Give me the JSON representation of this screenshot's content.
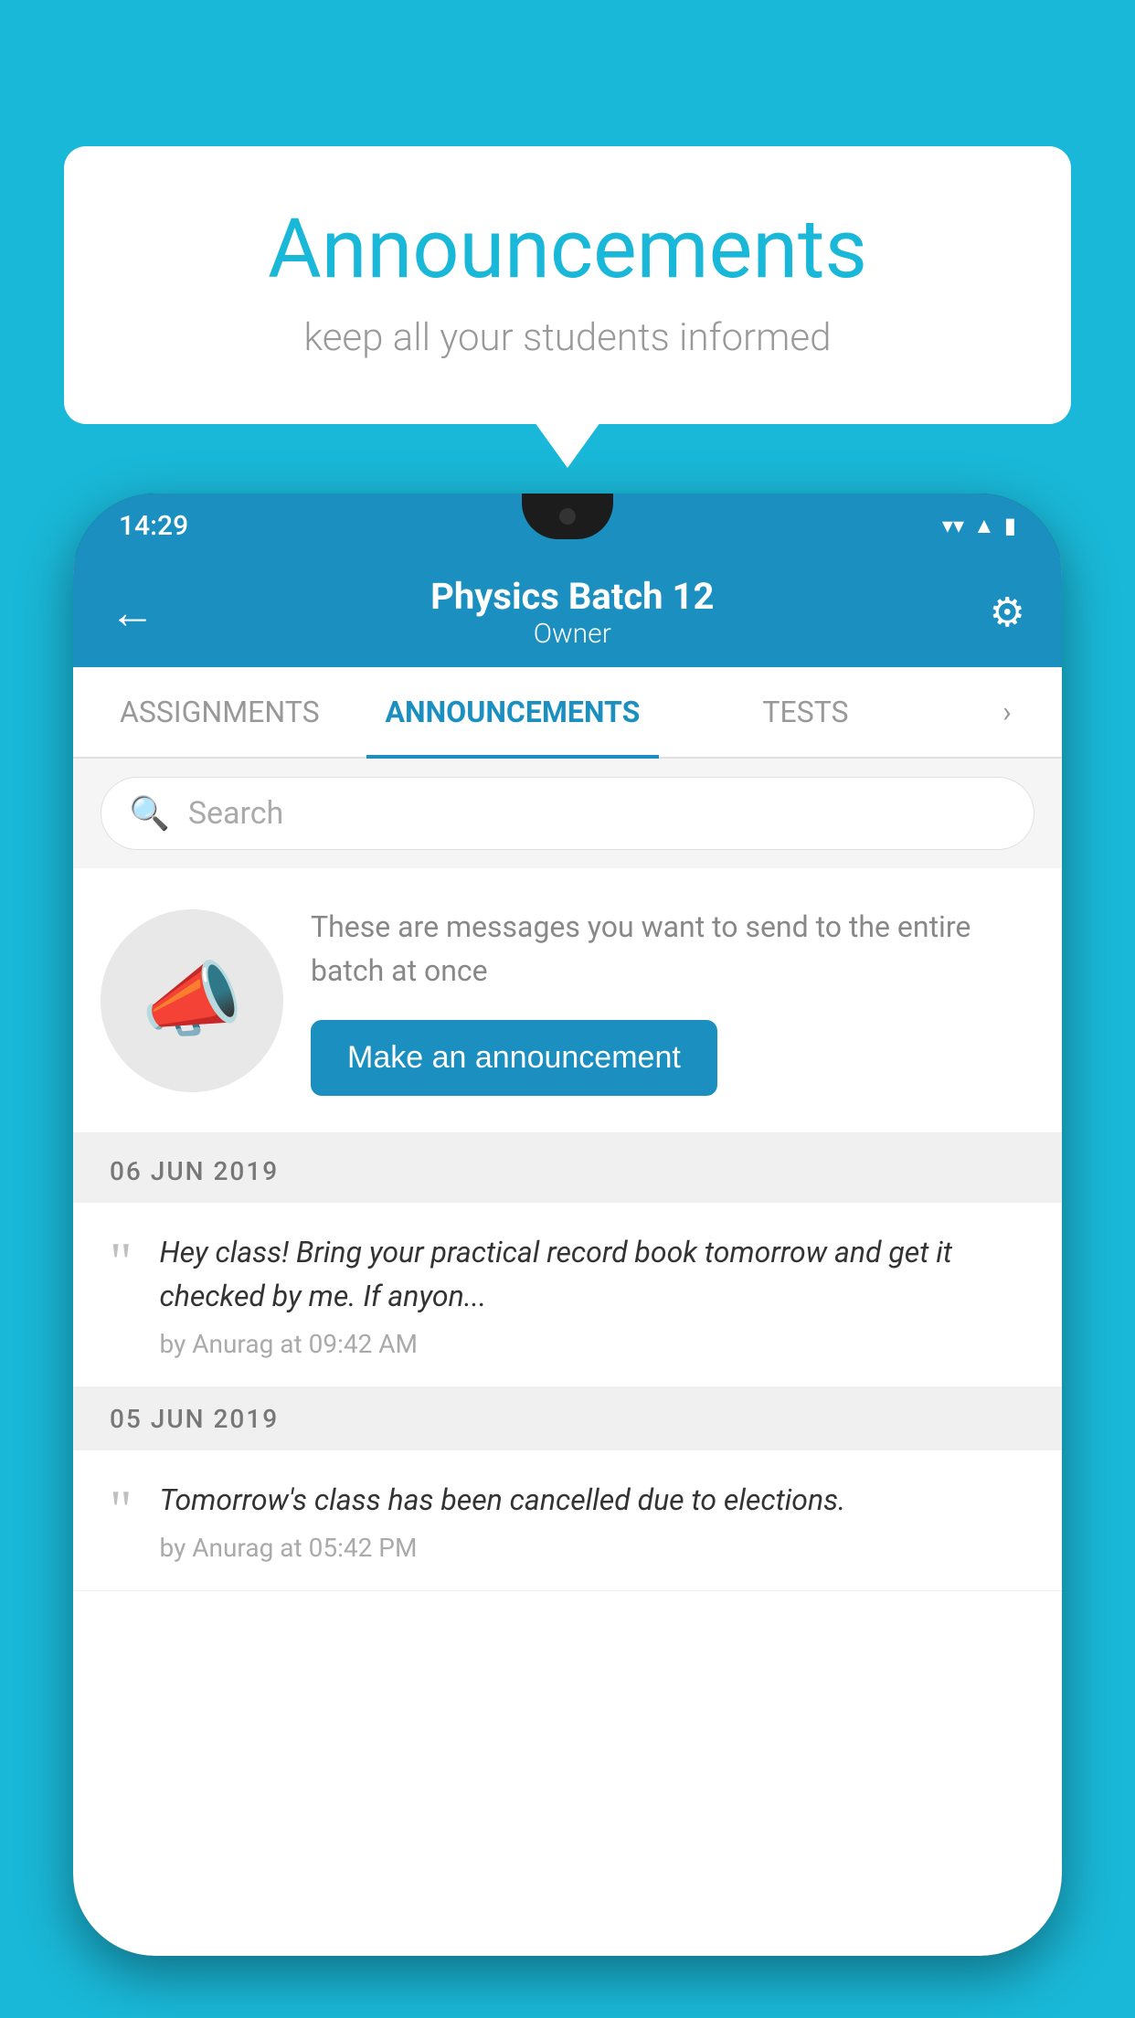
{
  "page": {
    "background_color": "#1ab8d8"
  },
  "speech_bubble": {
    "title": "Announcements",
    "subtitle": "keep all your students informed"
  },
  "status_bar": {
    "time": "14:29",
    "icons": [
      "wifi",
      "signal",
      "battery"
    ]
  },
  "app_header": {
    "title": "Physics Batch 12",
    "subtitle": "Owner",
    "back_label": "←",
    "settings_label": "⚙"
  },
  "tabs": [
    {
      "label": "ASSIGNMENTS",
      "active": false
    },
    {
      "label": "ANNOUNCEMENTS",
      "active": true
    },
    {
      "label": "TESTS",
      "active": false
    }
  ],
  "search": {
    "placeholder": "Search"
  },
  "promo": {
    "description": "These are messages you want to\nsend to the entire batch at once",
    "button_label": "Make an announcement"
  },
  "announcement_groups": [
    {
      "date": "06  JUN  2019",
      "items": [
        {
          "message": "Hey class! Bring your practical record book tomorrow and get it checked by me. If anyon...",
          "author": "by Anurag at 09:42 AM"
        }
      ]
    },
    {
      "date": "05  JUN  2019",
      "items": [
        {
          "message": "Tomorrow's class has been cancelled due to elections.",
          "author": "by Anurag at 05:42 PM"
        }
      ]
    }
  ]
}
